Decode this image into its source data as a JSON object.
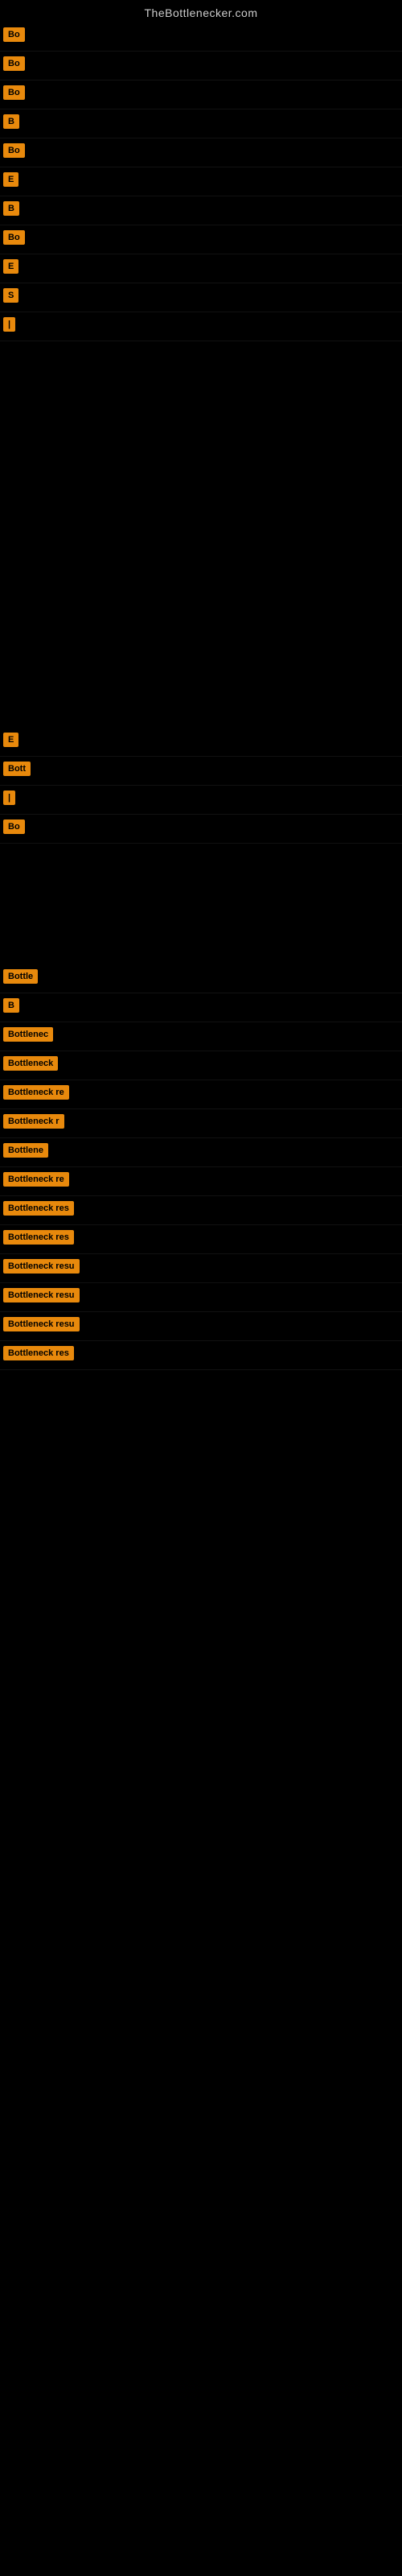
{
  "site": {
    "title": "TheBottlenecker.com"
  },
  "rows": [
    {
      "id": 1,
      "badge": "Bo",
      "text": ""
    },
    {
      "id": 2,
      "badge": "Bo",
      "text": ""
    },
    {
      "id": 3,
      "badge": "Bo",
      "text": ""
    },
    {
      "id": 4,
      "badge": "B",
      "text": ""
    },
    {
      "id": 5,
      "badge": "Bo",
      "text": ""
    },
    {
      "id": 6,
      "badge": "E",
      "text": ""
    },
    {
      "id": 7,
      "badge": "B",
      "text": ""
    },
    {
      "id": 8,
      "badge": "Bo",
      "text": ""
    },
    {
      "id": 9,
      "badge": "E",
      "text": ""
    },
    {
      "id": 10,
      "badge": "S",
      "text": ""
    },
    {
      "id": 11,
      "badge": "|",
      "text": ""
    }
  ],
  "rows2": [
    {
      "id": 12,
      "badge": "E",
      "text": ""
    },
    {
      "id": 13,
      "badge": "Bott",
      "text": ""
    },
    {
      "id": 14,
      "badge": "|",
      "text": ""
    },
    {
      "id": 15,
      "badge": "Bo",
      "text": ""
    }
  ],
  "rows3": [
    {
      "id": 16,
      "badge": "Bottle",
      "text": ""
    },
    {
      "id": 17,
      "badge": "B",
      "text": ""
    },
    {
      "id": 18,
      "badge": "Bottlenec",
      "text": ""
    },
    {
      "id": 19,
      "badge": "Bottleneck",
      "text": ""
    },
    {
      "id": 20,
      "badge": "Bottleneck re",
      "text": ""
    },
    {
      "id": 21,
      "badge": "Bottleneck r",
      "text": ""
    },
    {
      "id": 22,
      "badge": "Bottlene",
      "text": ""
    },
    {
      "id": 23,
      "badge": "Bottleneck re",
      "text": ""
    },
    {
      "id": 24,
      "badge": "Bottleneck res",
      "text": ""
    },
    {
      "id": 25,
      "badge": "Bottleneck res",
      "text": ""
    },
    {
      "id": 26,
      "badge": "Bottleneck resu",
      "text": ""
    },
    {
      "id": 27,
      "badge": "Bottleneck resu",
      "text": ""
    },
    {
      "id": 28,
      "badge": "Bottleneck resu",
      "text": ""
    },
    {
      "id": 29,
      "badge": "Bottleneck res",
      "text": ""
    }
  ]
}
